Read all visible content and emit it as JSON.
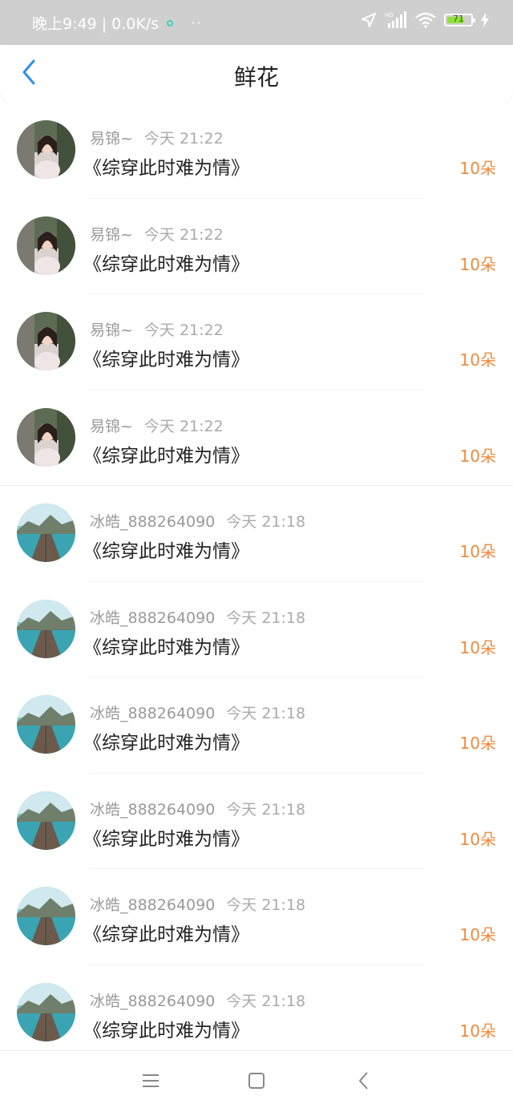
{
  "status_bar": {
    "time_speed": "晚上9:49 | 0.0K/s",
    "more": "··",
    "battery_level": "71",
    "battery_color": "#8ee23a",
    "icons": [
      "location-arrow-icon",
      "hd-signal-icon",
      "wifi-icon",
      "battery-icon",
      "charging-bolt-icon"
    ]
  },
  "header": {
    "title": "鲜花",
    "back_icon": "chevron-left-icon",
    "accent": "#2f8ff0"
  },
  "accent_amount_color": "#f08a3e",
  "records": [
    {
      "user": "易锦~",
      "time": "今天 21:22",
      "book": "《综穿此时难为情》",
      "amount": "10朵",
      "avatar": "woman-portrait-avatar"
    },
    {
      "user": "易锦~",
      "time": "今天 21:22",
      "book": "《综穿此时难为情》",
      "amount": "10朵",
      "avatar": "woman-portrait-avatar"
    },
    {
      "user": "易锦~",
      "time": "今天 21:22",
      "book": "《综穿此时难为情》",
      "amount": "10朵",
      "avatar": "woman-portrait-avatar"
    },
    {
      "user": "易锦~",
      "time": "今天 21:22",
      "book": "《综穿此时难为情》",
      "amount": "10朵",
      "avatar": "woman-portrait-avatar"
    },
    {
      "user": "冰皓_888264090",
      "time": "今天 21:18",
      "book": "《综穿此时难为情》",
      "amount": "10朵",
      "avatar": "lake-pier-avatar"
    },
    {
      "user": "冰皓_888264090",
      "time": "今天 21:18",
      "book": "《综穿此时难为情》",
      "amount": "10朵",
      "avatar": "lake-pier-avatar"
    },
    {
      "user": "冰皓_888264090",
      "time": "今天 21:18",
      "book": "《综穿此时难为情》",
      "amount": "10朵",
      "avatar": "lake-pier-avatar"
    },
    {
      "user": "冰皓_888264090",
      "time": "今天 21:18",
      "book": "《综穿此时难为情》",
      "amount": "10朵",
      "avatar": "lake-pier-avatar"
    },
    {
      "user": "冰皓_888264090",
      "time": "今天 21:18",
      "book": "《综穿此时难为情》",
      "amount": "10朵",
      "avatar": "lake-pier-avatar"
    },
    {
      "user": "冰皓_888264090",
      "time": "今天 21:18",
      "book": "《综穿此时难为情》",
      "amount": "10朵",
      "avatar": "lake-pier-avatar"
    }
  ],
  "nav_bar": {
    "icons": [
      "menu-icon",
      "home-square-icon",
      "back-chevron-icon"
    ]
  }
}
